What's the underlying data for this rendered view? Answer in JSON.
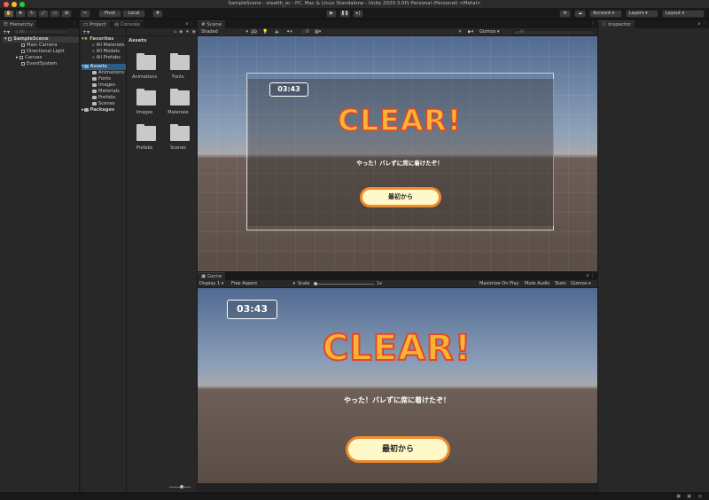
{
  "window": {
    "title": "SampleScene - stealth_er - PC, Mac & Linux Standalone - Unity 2020.3.0f1 Personal (Personal) <Metal>"
  },
  "toolbar": {
    "pivot_label": "Pivot",
    "local_label": "Local",
    "account_label": "Account",
    "layers_label": "Layers",
    "layout_label": "Layout"
  },
  "hierarchy": {
    "tab": "Hierarchy",
    "search_placeholder": "All",
    "scene": "SampleScene",
    "items": [
      "Main Camera",
      "Directional Light",
      "Canvas",
      "EventSystem"
    ]
  },
  "project": {
    "tab_project": "Project",
    "tab_console": "Console",
    "favorites_label": "Favorites",
    "favorites": [
      "All Materials",
      "All Models",
      "All Prefabs"
    ],
    "assets_label": "Assets",
    "asset_tree": [
      "Animations",
      "Fonts",
      "Images",
      "Materials",
      "Prefabs",
      "Scenes"
    ],
    "packages_label": "Packages",
    "breadcrumb": "Assets",
    "folders": [
      "Animations",
      "Fonts",
      "Images",
      "Materiale",
      "Prefabs",
      "Scenes"
    ]
  },
  "scene_view": {
    "tab": "Scene",
    "shading": "Shaded",
    "mode_2d": "2D",
    "gizmos": "Gizmos",
    "search_placeholder": "All",
    "timer": "03:43",
    "clear_text": "CLEAR!",
    "message": "やった！バレずに席に着けたぞ！",
    "button_label": "最初から"
  },
  "game_view": {
    "tab": "Game",
    "display": "Display 1",
    "aspect": "Free Aspect",
    "scale_label": "Scale",
    "scale_value": "1x",
    "maximize": "Maximize On Play",
    "mute": "Mute Audio",
    "stats": "Stats",
    "gizmos": "Gizmos",
    "timer": "03:43",
    "clear_text": "CLEAR!",
    "message": "やった！バレずに席に着けたぞ！",
    "button_label": "最初から"
  },
  "inspector": {
    "tab": "Inspector"
  },
  "colors": {
    "accent_blue": "#3a72b0",
    "clear_fill": "#f9b437",
    "clear_outline": "#e0482a",
    "button_fill": "#fff8c8",
    "button_border": "#f08a2b"
  }
}
